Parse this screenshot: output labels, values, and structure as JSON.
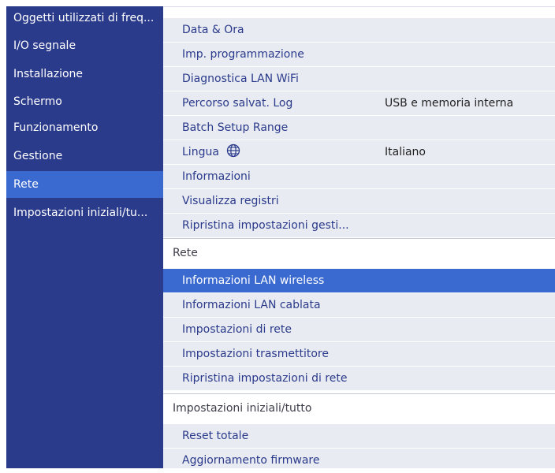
{
  "sidebar": {
    "items": [
      {
        "label": "Oggetti utilizzati di freq..."
      },
      {
        "label": "I/O segnale"
      },
      {
        "label": "Installazione"
      },
      {
        "label": "Schermo"
      },
      {
        "label": "Funzionamento"
      },
      {
        "label": "Gestione"
      },
      {
        "label": "Rete"
      },
      {
        "label": "Impostazioni iniziali/tu..."
      }
    ],
    "active_item": "Rete"
  },
  "gestione": {
    "data_ora": "Data & Ora",
    "imp_programmazione": "Imp. programmazione",
    "diagnostica_lan": "Diagnostica LAN WiFi",
    "percorso_log": {
      "label": "Percorso salvat. Log",
      "value": "USB e memoria interna"
    },
    "batch_setup": "Batch Setup Range",
    "lingua": {
      "label": "Lingua",
      "icon": "globe-icon",
      "value": "Italiano"
    },
    "informazioni": "Informazioni",
    "visualizza_registri": "Visualizza registri",
    "ripristina_gestione": "Ripristina impostazioni gesti..."
  },
  "rete": {
    "heading": "Rete",
    "items": [
      {
        "label": "Informazioni LAN wireless"
      },
      {
        "label": "Informazioni LAN cablata"
      },
      {
        "label": "Impostazioni di rete"
      },
      {
        "label": "Impostazioni trasmettitore"
      },
      {
        "label": "Ripristina impostazioni di rete"
      }
    ],
    "selected_item": "Informazioni LAN wireless"
  },
  "iniziali": {
    "heading": "Impostazioni iniziali/tutto",
    "items": [
      {
        "label": "Reset totale"
      },
      {
        "label": "Aggiornamento firmware"
      }
    ]
  },
  "colors": {
    "sidebar_bg": "#2b3b8c",
    "selection": "#3a6ad0",
    "menu_row_bg": "#e9ebf3",
    "menu_text": "#2a3a8a"
  }
}
